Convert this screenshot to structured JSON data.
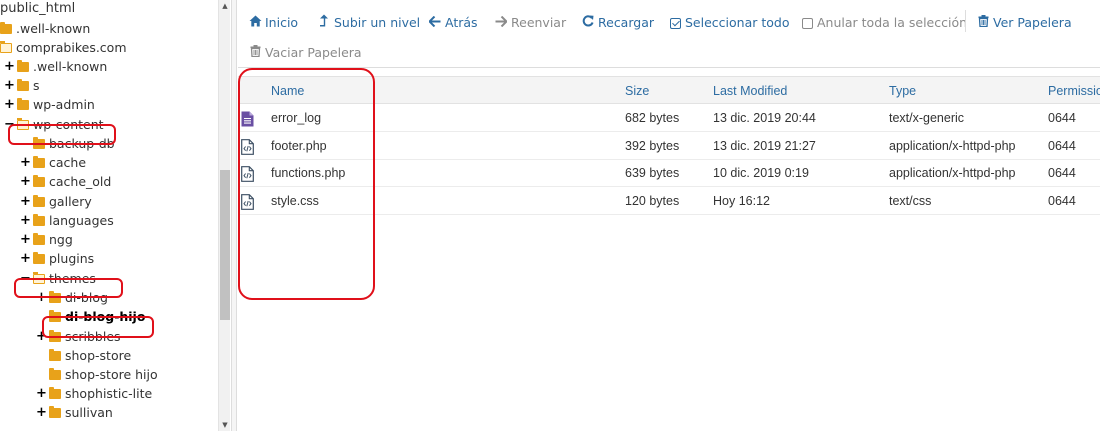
{
  "tree": {
    "items": [
      {
        "label": "public_html",
        "toggle": "",
        "folder": "none",
        "depth": 0,
        "bold": false
      },
      {
        "label": ".well-known",
        "toggle": "",
        "folder": "closed",
        "depth": 0,
        "bold": false
      },
      {
        "label": "comprabikes.com",
        "toggle": "",
        "folder": "open",
        "depth": 0,
        "bold": false
      },
      {
        "label": ".well-known",
        "toggle": "+",
        "folder": "closed",
        "depth": 1,
        "bold": false
      },
      {
        "label": "s",
        "toggle": "+",
        "folder": "closed",
        "depth": 1,
        "bold": false
      },
      {
        "label": "wp-admin",
        "toggle": "+",
        "folder": "closed",
        "depth": 1,
        "bold": false
      },
      {
        "label": "wp-content",
        "toggle": "−",
        "folder": "open",
        "depth": 1,
        "bold": false
      },
      {
        "label": "backup-db",
        "toggle": "",
        "folder": "closed",
        "depth": 2,
        "bold": false
      },
      {
        "label": "cache",
        "toggle": "+",
        "folder": "closed",
        "depth": 2,
        "bold": false
      },
      {
        "label": "cache_old",
        "toggle": "+",
        "folder": "closed",
        "depth": 2,
        "bold": false
      },
      {
        "label": "gallery",
        "toggle": "+",
        "folder": "closed",
        "depth": 2,
        "bold": false
      },
      {
        "label": "languages",
        "toggle": "+",
        "folder": "closed",
        "depth": 2,
        "bold": false
      },
      {
        "label": "ngg",
        "toggle": "+",
        "folder": "closed",
        "depth": 2,
        "bold": false
      },
      {
        "label": "plugins",
        "toggle": "+",
        "folder": "closed",
        "depth": 2,
        "bold": false
      },
      {
        "label": "themes",
        "toggle": "−",
        "folder": "open",
        "depth": 2,
        "bold": false
      },
      {
        "label": "di-blog",
        "toggle": "+",
        "folder": "closed",
        "depth": 3,
        "bold": false
      },
      {
        "label": "di-blog-hijo",
        "toggle": "",
        "folder": "closed",
        "depth": 3,
        "bold": true
      },
      {
        "label": "scribbles",
        "toggle": "+",
        "folder": "closed",
        "depth": 3,
        "bold": false
      },
      {
        "label": "shop-store",
        "toggle": "",
        "folder": "closed",
        "depth": 3,
        "bold": false
      },
      {
        "label": "shop-store hijo",
        "toggle": "",
        "folder": "closed",
        "depth": 3,
        "bold": false
      },
      {
        "label": "shophistic-lite",
        "toggle": "+",
        "folder": "closed",
        "depth": 3,
        "bold": false
      },
      {
        "label": "sullivan",
        "toggle": "+",
        "folder": "closed",
        "depth": 3,
        "bold": false
      }
    ]
  },
  "toolbar": {
    "home": "Inicio",
    "up": "Subir un nivel",
    "back": "Atrás",
    "forward": "Reenviar",
    "reload": "Recargar",
    "select_all": "Seleccionar todo",
    "deselect_all": "Anular toda la selección",
    "view_trash": "Ver Papelera",
    "empty_trash": "Vaciar Papelera"
  },
  "table": {
    "columns": {
      "name": "Name",
      "size": "Size",
      "modified": "Last Modified",
      "type": "Type",
      "perms": "Permissions"
    },
    "rows": [
      {
        "icon": "generic-file-icon",
        "name": "error_log",
        "size": "682 bytes",
        "modified": "13 dic. 2019 20:44",
        "type": "text/x-generic",
        "perms": "0644"
      },
      {
        "icon": "code-file-icon",
        "name": "footer.php",
        "size": "392 bytes",
        "modified": "13 dic. 2019 21:27",
        "type": "application/x-httpd-php",
        "perms": "0644"
      },
      {
        "icon": "code-file-icon",
        "name": "functions.php",
        "size": "639 bytes",
        "modified": "10 dic. 2019 0:19",
        "type": "application/x-httpd-php",
        "perms": "0644"
      },
      {
        "icon": "code-file-icon",
        "name": "style.css",
        "size": "120 bytes",
        "modified": "Hoy 16:12",
        "type": "text/css",
        "perms": "0644"
      }
    ]
  },
  "colors": {
    "link": "#2d6ca2",
    "folder": "#e8a21a",
    "annotation": "#e0101a",
    "generic_file": "#6a4fa3"
  }
}
